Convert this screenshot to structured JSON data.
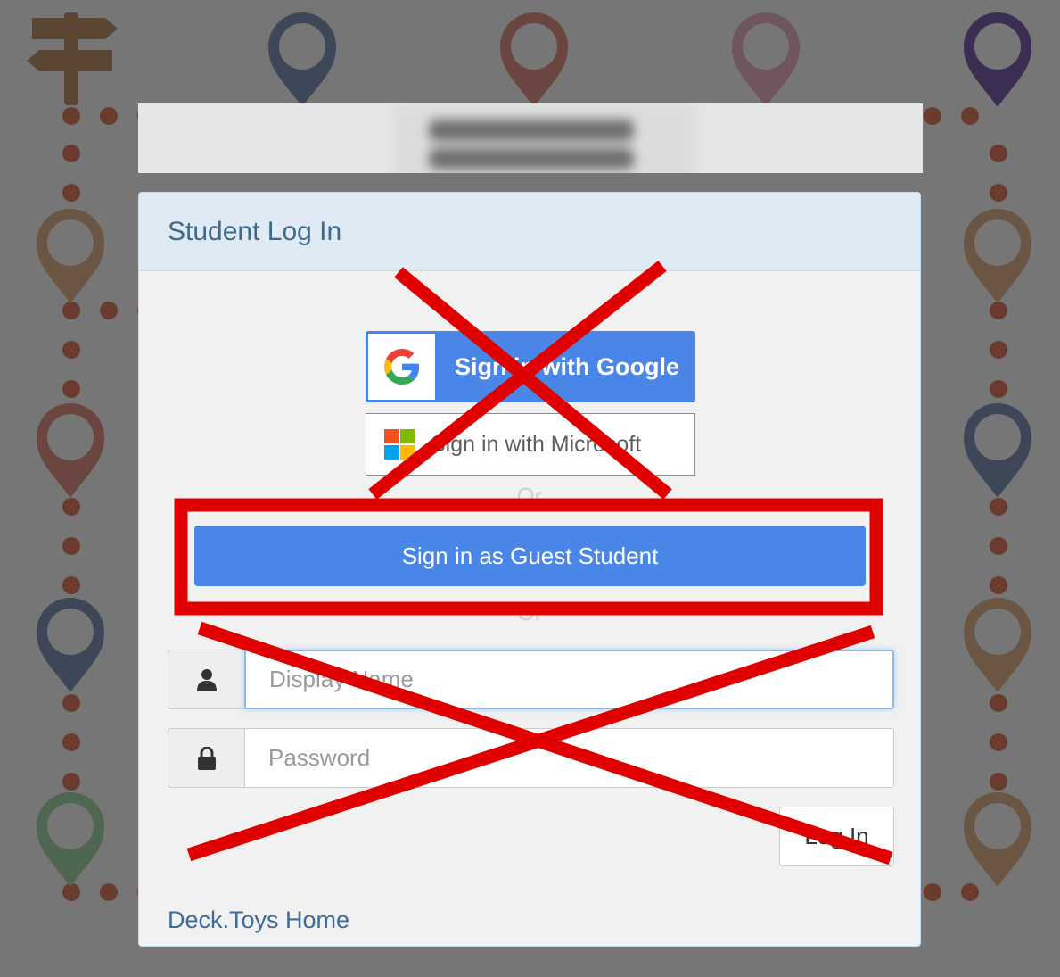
{
  "page": {
    "title": "Student Log In",
    "google_button": "Sign in with Google",
    "microsoft_button": "Sign in with Microsoft",
    "or_text_1": "Or",
    "guest_button": "Sign in as Guest Student",
    "or_text_2": "Or",
    "display_name_placeholder": "Display Name",
    "password_placeholder": "Password",
    "login_button": "Log In",
    "home_link": "Deck.Toys Home"
  },
  "icons": {
    "google": "google-g-logo",
    "microsoft": "microsoft-logo",
    "user": "user-icon",
    "lock": "lock-icon",
    "signpost": "signpost-icon",
    "pin": "map-pin-icon"
  },
  "colors": {
    "background": "#767676",
    "accent_blue": "#4a86e8",
    "annotation_red": "#e00000",
    "header_bg": "#dfeaf4",
    "title_text": "#3f6a8a"
  }
}
